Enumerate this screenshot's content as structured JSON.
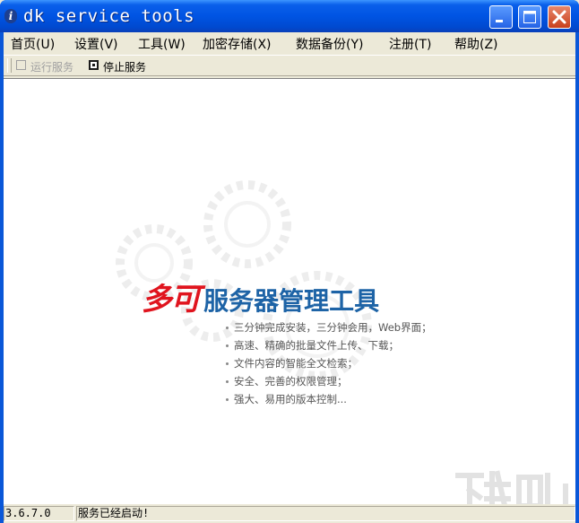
{
  "window": {
    "title": "dk service tools"
  },
  "menu": [
    {
      "label": "首页(U)"
    },
    {
      "label": "设置(V)"
    },
    {
      "label": "工具(W)"
    },
    {
      "label": "加密存储(X)"
    },
    {
      "label": "数据备份(Y)"
    },
    {
      "label": "注册(T)"
    },
    {
      "label": "帮助(Z)"
    }
  ],
  "toolbar": {
    "run_label": "运行服务",
    "run_enabled": false,
    "stop_label": "停止服务",
    "stop_enabled": true
  },
  "content": {
    "brand_red": "多可",
    "brand_blue": "服务器管理工具",
    "features": [
      "三分钟完成安装，三分钟会用，Web界面；",
      "高速、精确的批量文件上传、下载；",
      "文件内容的智能全文检索；",
      "安全、完善的权限管理；",
      "强大、易用的版本控制..."
    ]
  },
  "status": {
    "version": "3.6.7.0",
    "message": "服务已经启动!"
  },
  "colors": {
    "titlebar": "#0054E3",
    "brand_red": "#E0141E",
    "brand_blue": "#1D63A6"
  }
}
